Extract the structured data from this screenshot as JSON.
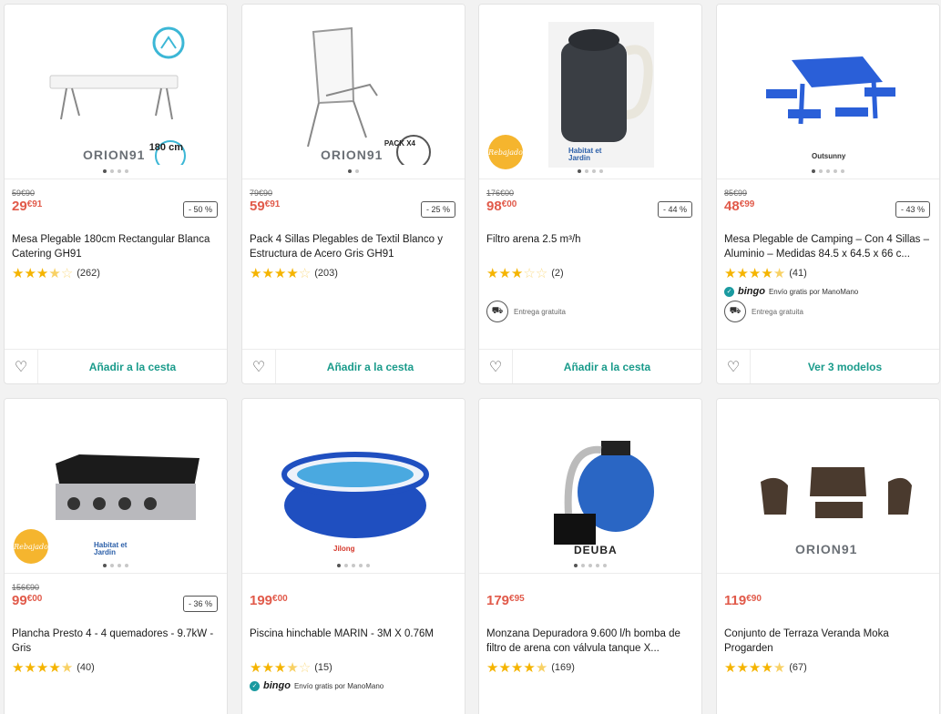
{
  "products": [
    {
      "brand": "ORION91",
      "old_price": "59€90",
      "price_int": "29",
      "price_dec": "€91",
      "discount": "- 50 %",
      "title": "Mesa Plegable 180cm Rectangular Blanca Catering GH91",
      "rating": 3.5,
      "reviews": "(262)",
      "cta": "Añadir a la cesta",
      "overlay": "180 cm"
    },
    {
      "brand": "ORION91",
      "old_price": "79€90",
      "price_int": "59",
      "price_dec": "€91",
      "discount": "- 25 %",
      "title": "Pack 4 Sillas Plegables de Textil Blanco y Estructura de Acero Gris GH91",
      "rating": 4,
      "reviews": "(203)",
      "cta": "Añadir a la cesta",
      "overlay": "PACK X4"
    },
    {
      "brand": "Habitat et Jardin",
      "old_price": "176€00",
      "price_int": "98",
      "price_dec": "€00",
      "discount": "- 44 %",
      "title": "Filtro arena 2.5 m³/h",
      "rating": 3,
      "reviews": "(2)",
      "delivery": "Entrega gratuita",
      "cta": "Añadir a la cesta",
      "badge": "Rebajado"
    },
    {
      "brand": "Outsunny",
      "old_price": "85€99",
      "price_int": "48",
      "price_dec": "€99",
      "discount": "- 43 %",
      "title": "Mesa Plegable de Camping – Con 4 Sillas – Aluminio – Medidas 84.5 x 64.5 x 66 c...",
      "rating": 4.5,
      "reviews": "(41)",
      "bingo": "bingo",
      "bingo_text": "Envío gratis por ManoMano",
      "delivery": "Entrega gratuita",
      "cta": "Ver 3 modelos"
    },
    {
      "brand": "Habitat et Jardin",
      "old_price": "156€90",
      "price_int": "99",
      "price_dec": "€00",
      "discount": "- 36 %",
      "title": "Plancha Presto 4 - 4 quemadores - 9.7kW - Gris",
      "rating": 4.5,
      "reviews": "(40)",
      "badge": "Rebajado"
    },
    {
      "brand": "Jilong",
      "old_price": "",
      "price_int": "199",
      "price_dec": "€00",
      "discount": "",
      "title": "Piscina hinchable MARIN - 3M X 0.76M",
      "rating": 3.5,
      "reviews": "(15)",
      "bingo": "bingo",
      "bingo_text": "Envío gratis por ManoMano"
    },
    {
      "brand": "DEUBA",
      "old_price": "",
      "price_int": "179",
      "price_dec": "€95",
      "discount": "",
      "title": "Monzana Depuradora 9.600 l/h bomba de filtro de arena con válvula tanque X...",
      "rating": 4.5,
      "reviews": "(169)"
    },
    {
      "brand": "ORION91",
      "old_price": "",
      "price_int": "119",
      "price_dec": "€90",
      "discount": "",
      "title": "Conjunto de Terraza Veranda Moka Progarden",
      "rating": 4.5,
      "reviews": "(67)"
    }
  ],
  "icons": {
    "favorite": "heart-outline-icon",
    "delivery": "truck-icon",
    "star": "star-icon"
  },
  "colors": {
    "price": "#e15a4a",
    "cta": "#1a9b8b",
    "star": "#f5b400",
    "badge": "#f5b52e"
  }
}
